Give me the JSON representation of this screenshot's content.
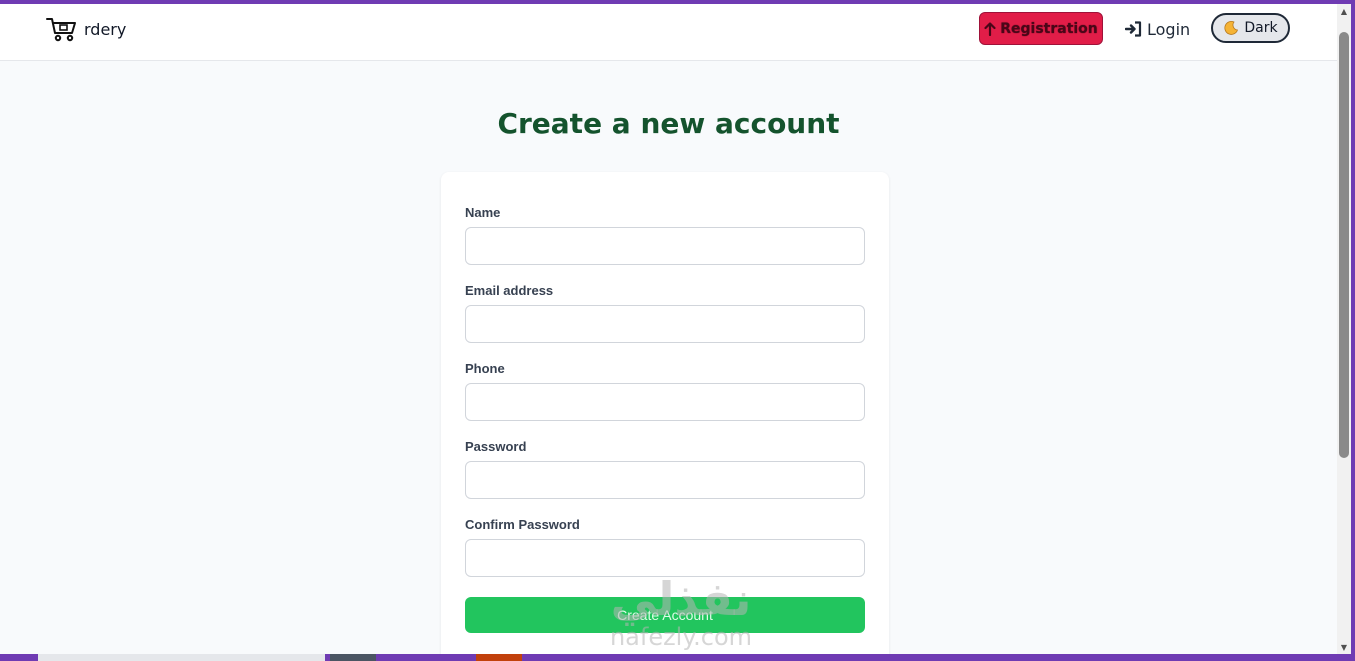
{
  "navbar": {
    "brand_name": "rdery",
    "registration_label": "Registration",
    "login_label": "Login",
    "theme_toggle_label": "Dark"
  },
  "page": {
    "title": "Create a new account"
  },
  "form": {
    "name_label": "Name",
    "email_label": "Email address",
    "phone_label": "Phone",
    "password_label": "Password",
    "confirm_password_label": "Confirm Password",
    "submit_label": "Create Account"
  },
  "watermark": {
    "arabic": "نفذلي",
    "latin": "nafezly.com"
  },
  "colors": {
    "heading": "#14532d",
    "registration_bg": "#e11d48",
    "submit_bg": "#22c55e",
    "window_border": "#6f3bb3"
  }
}
